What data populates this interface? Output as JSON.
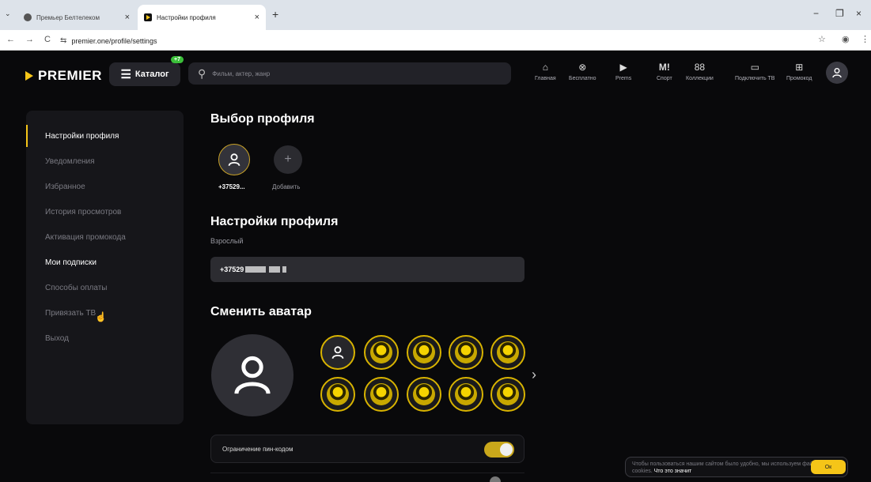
{
  "browser": {
    "tabs": [
      {
        "title": "Премьер Белтелеком",
        "close": "×",
        "active": false
      },
      {
        "title": "Настройки профиля",
        "close": "×",
        "active": true
      }
    ],
    "new_tab": "+",
    "tab_search": "⌄",
    "window_controls": {
      "minimize": "−",
      "maximize": "❐",
      "close": "×"
    },
    "nav": {
      "back": "←",
      "forward": "→",
      "reload": "C"
    },
    "url": "premier.one/profile/settings",
    "site_info_icon": "⇆",
    "bookmark_icon": "☆",
    "profile_icon": "◉",
    "menu_icon": "⋮"
  },
  "header": {
    "logo": "PREMIER",
    "catalog_label": "Каталог",
    "catalog_badge": "+7",
    "search_placeholder": "Фильм, актер, жанр",
    "nav": [
      {
        "label": "Главная",
        "icon": "⌂"
      },
      {
        "label": "Бесплатно",
        "icon": "⊗"
      },
      {
        "label": "Prems",
        "icon": "▶"
      },
      {
        "label": "Спорт",
        "icon": "M!"
      },
      {
        "label": "Коллекции",
        "icon": "88"
      },
      {
        "label": "Подключить ТВ",
        "icon": "▭"
      },
      {
        "label": "Промокод",
        "icon": "⊞"
      }
    ]
  },
  "sidebar": {
    "items": [
      {
        "label": "Настройки профиля",
        "state": "active"
      },
      {
        "label": "Уведомления",
        "state": "normal"
      },
      {
        "label": "Избранное",
        "state": "normal"
      },
      {
        "label": "История просмотров",
        "state": "normal"
      },
      {
        "label": "Активация промокода",
        "state": "normal"
      },
      {
        "label": "Мои подписки",
        "state": "hover"
      },
      {
        "label": "Способы оплаты",
        "state": "normal"
      },
      {
        "label": "Привязать ТВ",
        "state": "normal"
      },
      {
        "label": "Выход",
        "state": "normal"
      }
    ]
  },
  "main": {
    "profile_select_title": "Выбор профиля",
    "profiles": [
      {
        "label": "+37529..."
      },
      {
        "label": "Добавить"
      }
    ],
    "profile_settings_title": "Настройки профиля",
    "profile_type": "Взрослый",
    "phone_value": "+37529",
    "change_avatar_title": "Сменить аватар",
    "pin_label": "Ограничение пин-кодом",
    "pin_enabled": true
  },
  "cookie": {
    "text": "Чтобы пользоваться нашим сайтом было удобно, мы используем файлы cookies.",
    "link": "Что это значит",
    "ok": "Ок"
  },
  "colors": {
    "accent": "#f5c518",
    "background": "#09090b",
    "panel": "#16161a"
  }
}
